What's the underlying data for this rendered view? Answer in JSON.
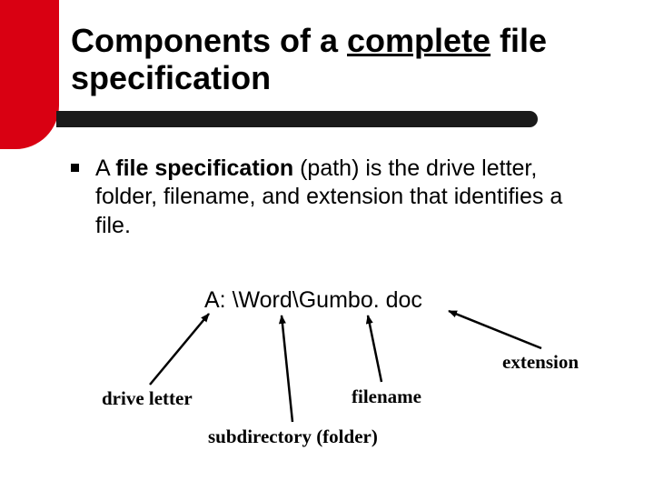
{
  "title": {
    "prefix": "Components of a ",
    "underlined": "complete",
    "suffix": " file specification"
  },
  "bullet": {
    "lead": "A ",
    "bold": "file specification",
    "rest": " (path) is the drive letter, folder, filename, and extension that identifies a file."
  },
  "example_path": "A: \\Word\\Gumbo. doc",
  "labels": {
    "extension": "extension",
    "filename": "filename",
    "drive_letter": "drive letter",
    "subdirectory": "subdirectory (folder)"
  }
}
